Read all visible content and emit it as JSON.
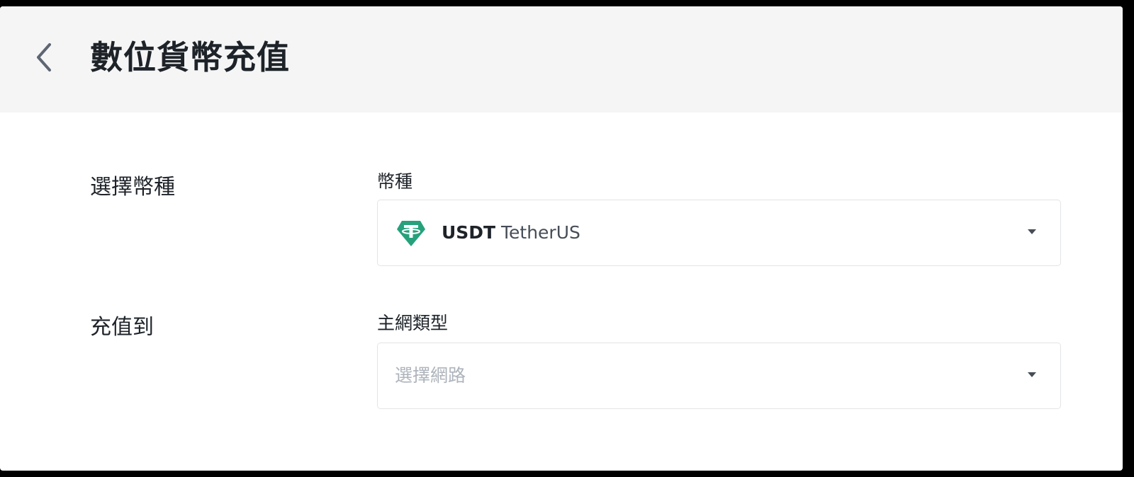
{
  "header": {
    "title": "數位貨幣充值",
    "back_icon": "chevron-left-icon"
  },
  "coin_section": {
    "section_label": "選擇幣種",
    "field_label": "幣種",
    "selected_symbol": "USDT",
    "selected_name": "TetherUS",
    "coin_icon": "tether-icon",
    "coin_icon_color": "#26a17b"
  },
  "network_section": {
    "section_label": "充值到",
    "field_label": "主網類型",
    "placeholder": "選擇網路"
  },
  "colors": {
    "header_bg": "#f5f5f5",
    "text_primary": "#1e2329",
    "placeholder": "#aeb4bc",
    "border": "#e2e4e8"
  }
}
